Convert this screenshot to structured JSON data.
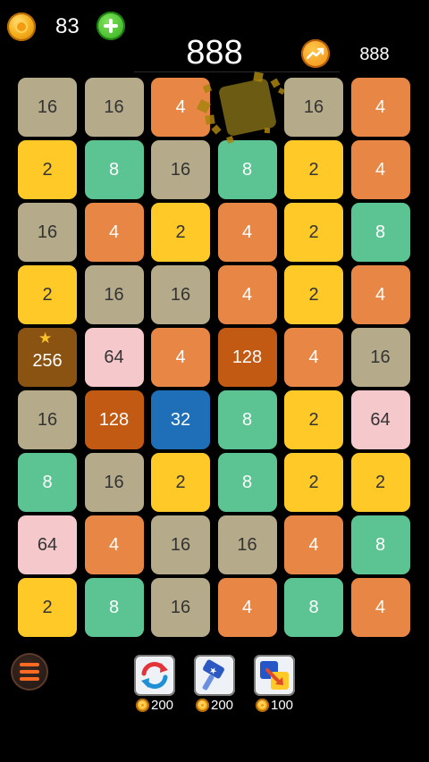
{
  "header": {
    "coins": "83",
    "score": "888",
    "best_score": "888",
    "coin_icon": "coin-icon",
    "add_icon": "plus-icon",
    "best_icon": "trend-up-icon"
  },
  "board": {
    "columns": 6,
    "rows": 9,
    "cells": [
      [
        "16",
        "16",
        "4",
        "",
        "16",
        "4"
      ],
      [
        "2",
        "8",
        "16",
        "8",
        "2",
        "4"
      ],
      [
        "16",
        "4",
        "2",
        "4",
        "2",
        "8"
      ],
      [
        "2",
        "16",
        "16",
        "4",
        "2",
        "4"
      ],
      [
        "256",
        "64",
        "4",
        "128",
        "4",
        "16"
      ],
      [
        "16",
        "128",
        "32",
        "8",
        "2",
        "64"
      ],
      [
        "8",
        "16",
        "2",
        "8",
        "2",
        "2"
      ],
      [
        "64",
        "4",
        "16",
        "16",
        "4",
        "8"
      ],
      [
        "2",
        "8",
        "16",
        "4",
        "8",
        "4"
      ]
    ],
    "hit_cell": [
      0,
      3
    ],
    "starred_cell": [
      4,
      0
    ],
    "star_icon": "star-icon"
  },
  "tile_colors": {
    "2": "#ffc928",
    "4": "#e88646",
    "8": "#5cc493",
    "16": "#b5ab8a",
    "32": "#1f6fb8",
    "64": "#f5c8cc",
    "128": "#c25a14",
    "256": "#8a5312",
    "hit": "#6b5b13"
  },
  "footer": {
    "menu_icon": "menu-icon",
    "powerups": [
      {
        "name": "shuffle",
        "icon": "shuffle-icon",
        "price": "200"
      },
      {
        "name": "hammer",
        "icon": "hammer-icon",
        "price": "200"
      },
      {
        "name": "swap",
        "icon": "swap-icon",
        "price": "100"
      }
    ]
  }
}
